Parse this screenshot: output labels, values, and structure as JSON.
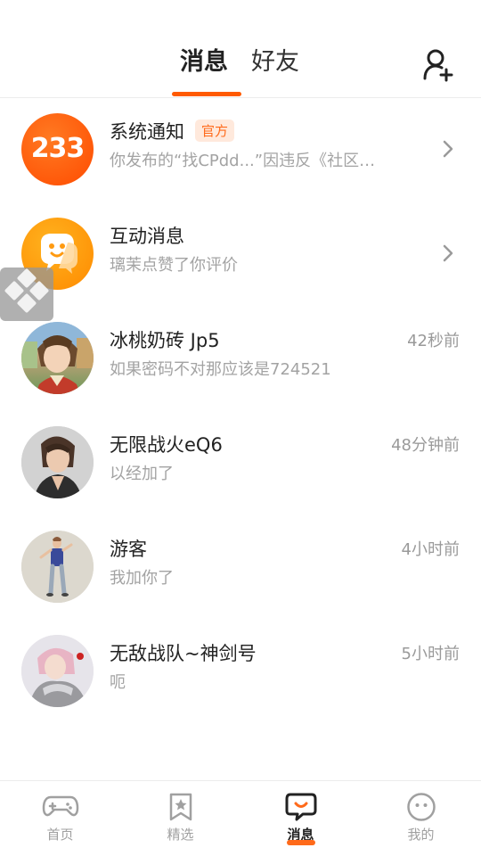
{
  "header": {
    "tabs": [
      {
        "label": "消息",
        "active": true
      },
      {
        "label": "好友",
        "active": false
      }
    ],
    "add_friend_icon": "add-user-icon"
  },
  "conversations": [
    {
      "avatar_text": "233",
      "name": "系统通知",
      "badge": "官方",
      "preview": "你发布的“找CPdd...”因违反《社区…",
      "time": "",
      "has_chevron": true
    },
    {
      "avatar_text": "",
      "name": "互动消息",
      "badge": "",
      "preview": "璃茉点赞了你评价",
      "time": "",
      "has_chevron": true
    },
    {
      "avatar_text": "",
      "name": "冰桃奶砖 Jp5",
      "badge": "",
      "preview": "如果密码不对那应该是724521",
      "time": "42秒前",
      "has_chevron": false
    },
    {
      "avatar_text": "",
      "name": "无限战火eQ6",
      "badge": "",
      "preview": "以经加了",
      "time": "48分钟前",
      "has_chevron": false
    },
    {
      "avatar_text": "",
      "name": "游客",
      "badge": "",
      "preview": "我加你了",
      "time": "4小时前",
      "has_chevron": false
    },
    {
      "avatar_text": "",
      "name": "无敌战队~神剑号",
      "badge": "",
      "preview": "呃",
      "time": "5小时前",
      "has_chevron": false
    }
  ],
  "bottom_nav": [
    {
      "label": "首页",
      "icon": "gamepad-icon",
      "active": false
    },
    {
      "label": "精选",
      "icon": "star-bookmark-icon",
      "active": false
    },
    {
      "label": "消息",
      "icon": "chat-bubble-icon",
      "active": true
    },
    {
      "label": "我的",
      "icon": "smiley-face-icon",
      "active": false
    }
  ],
  "colors": {
    "accent": "#ff5a00",
    "badge_bg": "#ffe9dc",
    "muted_text": "#a3a3a3"
  }
}
